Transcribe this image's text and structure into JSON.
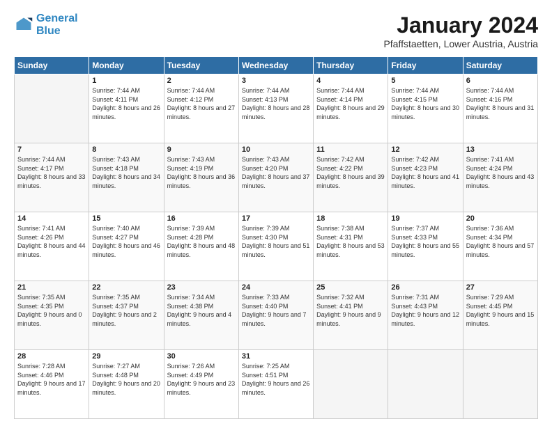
{
  "logo": {
    "line1": "General",
    "line2": "Blue"
  },
  "title": "January 2024",
  "subtitle": "Pfaffstaetten, Lower Austria, Austria",
  "headers": [
    "Sunday",
    "Monday",
    "Tuesday",
    "Wednesday",
    "Thursday",
    "Friday",
    "Saturday"
  ],
  "weeks": [
    [
      {
        "day": "",
        "sunrise": "",
        "sunset": "",
        "daylight": ""
      },
      {
        "day": "1",
        "sunrise": "Sunrise: 7:44 AM",
        "sunset": "Sunset: 4:11 PM",
        "daylight": "Daylight: 8 hours and 26 minutes."
      },
      {
        "day": "2",
        "sunrise": "Sunrise: 7:44 AM",
        "sunset": "Sunset: 4:12 PM",
        "daylight": "Daylight: 8 hours and 27 minutes."
      },
      {
        "day": "3",
        "sunrise": "Sunrise: 7:44 AM",
        "sunset": "Sunset: 4:13 PM",
        "daylight": "Daylight: 8 hours and 28 minutes."
      },
      {
        "day": "4",
        "sunrise": "Sunrise: 7:44 AM",
        "sunset": "Sunset: 4:14 PM",
        "daylight": "Daylight: 8 hours and 29 minutes."
      },
      {
        "day": "5",
        "sunrise": "Sunrise: 7:44 AM",
        "sunset": "Sunset: 4:15 PM",
        "daylight": "Daylight: 8 hours and 30 minutes."
      },
      {
        "day": "6",
        "sunrise": "Sunrise: 7:44 AM",
        "sunset": "Sunset: 4:16 PM",
        "daylight": "Daylight: 8 hours and 31 minutes."
      }
    ],
    [
      {
        "day": "7",
        "sunrise": "Sunrise: 7:44 AM",
        "sunset": "Sunset: 4:17 PM",
        "daylight": "Daylight: 8 hours and 33 minutes."
      },
      {
        "day": "8",
        "sunrise": "Sunrise: 7:43 AM",
        "sunset": "Sunset: 4:18 PM",
        "daylight": "Daylight: 8 hours and 34 minutes."
      },
      {
        "day": "9",
        "sunrise": "Sunrise: 7:43 AM",
        "sunset": "Sunset: 4:19 PM",
        "daylight": "Daylight: 8 hours and 36 minutes."
      },
      {
        "day": "10",
        "sunrise": "Sunrise: 7:43 AM",
        "sunset": "Sunset: 4:20 PM",
        "daylight": "Daylight: 8 hours and 37 minutes."
      },
      {
        "day": "11",
        "sunrise": "Sunrise: 7:42 AM",
        "sunset": "Sunset: 4:22 PM",
        "daylight": "Daylight: 8 hours and 39 minutes."
      },
      {
        "day": "12",
        "sunrise": "Sunrise: 7:42 AM",
        "sunset": "Sunset: 4:23 PM",
        "daylight": "Daylight: 8 hours and 41 minutes."
      },
      {
        "day": "13",
        "sunrise": "Sunrise: 7:41 AM",
        "sunset": "Sunset: 4:24 PM",
        "daylight": "Daylight: 8 hours and 43 minutes."
      }
    ],
    [
      {
        "day": "14",
        "sunrise": "Sunrise: 7:41 AM",
        "sunset": "Sunset: 4:26 PM",
        "daylight": "Daylight: 8 hours and 44 minutes."
      },
      {
        "day": "15",
        "sunrise": "Sunrise: 7:40 AM",
        "sunset": "Sunset: 4:27 PM",
        "daylight": "Daylight: 8 hours and 46 minutes."
      },
      {
        "day": "16",
        "sunrise": "Sunrise: 7:39 AM",
        "sunset": "Sunset: 4:28 PM",
        "daylight": "Daylight: 8 hours and 48 minutes."
      },
      {
        "day": "17",
        "sunrise": "Sunrise: 7:39 AM",
        "sunset": "Sunset: 4:30 PM",
        "daylight": "Daylight: 8 hours and 51 minutes."
      },
      {
        "day": "18",
        "sunrise": "Sunrise: 7:38 AM",
        "sunset": "Sunset: 4:31 PM",
        "daylight": "Daylight: 8 hours and 53 minutes."
      },
      {
        "day": "19",
        "sunrise": "Sunrise: 7:37 AM",
        "sunset": "Sunset: 4:33 PM",
        "daylight": "Daylight: 8 hours and 55 minutes."
      },
      {
        "day": "20",
        "sunrise": "Sunrise: 7:36 AM",
        "sunset": "Sunset: 4:34 PM",
        "daylight": "Daylight: 8 hours and 57 minutes."
      }
    ],
    [
      {
        "day": "21",
        "sunrise": "Sunrise: 7:35 AM",
        "sunset": "Sunset: 4:35 PM",
        "daylight": "Daylight: 9 hours and 0 minutes."
      },
      {
        "day": "22",
        "sunrise": "Sunrise: 7:35 AM",
        "sunset": "Sunset: 4:37 PM",
        "daylight": "Daylight: 9 hours and 2 minutes."
      },
      {
        "day": "23",
        "sunrise": "Sunrise: 7:34 AM",
        "sunset": "Sunset: 4:38 PM",
        "daylight": "Daylight: 9 hours and 4 minutes."
      },
      {
        "day": "24",
        "sunrise": "Sunrise: 7:33 AM",
        "sunset": "Sunset: 4:40 PM",
        "daylight": "Daylight: 9 hours and 7 minutes."
      },
      {
        "day": "25",
        "sunrise": "Sunrise: 7:32 AM",
        "sunset": "Sunset: 4:41 PM",
        "daylight": "Daylight: 9 hours and 9 minutes."
      },
      {
        "day": "26",
        "sunrise": "Sunrise: 7:31 AM",
        "sunset": "Sunset: 4:43 PM",
        "daylight": "Daylight: 9 hours and 12 minutes."
      },
      {
        "day": "27",
        "sunrise": "Sunrise: 7:29 AM",
        "sunset": "Sunset: 4:45 PM",
        "daylight": "Daylight: 9 hours and 15 minutes."
      }
    ],
    [
      {
        "day": "28",
        "sunrise": "Sunrise: 7:28 AM",
        "sunset": "Sunset: 4:46 PM",
        "daylight": "Daylight: 9 hours and 17 minutes."
      },
      {
        "day": "29",
        "sunrise": "Sunrise: 7:27 AM",
        "sunset": "Sunset: 4:48 PM",
        "daylight": "Daylight: 9 hours and 20 minutes."
      },
      {
        "day": "30",
        "sunrise": "Sunrise: 7:26 AM",
        "sunset": "Sunset: 4:49 PM",
        "daylight": "Daylight: 9 hours and 23 minutes."
      },
      {
        "day": "31",
        "sunrise": "Sunrise: 7:25 AM",
        "sunset": "Sunset: 4:51 PM",
        "daylight": "Daylight: 9 hours and 26 minutes."
      },
      {
        "day": "",
        "sunrise": "",
        "sunset": "",
        "daylight": ""
      },
      {
        "day": "",
        "sunrise": "",
        "sunset": "",
        "daylight": ""
      },
      {
        "day": "",
        "sunrise": "",
        "sunset": "",
        "daylight": ""
      }
    ]
  ]
}
